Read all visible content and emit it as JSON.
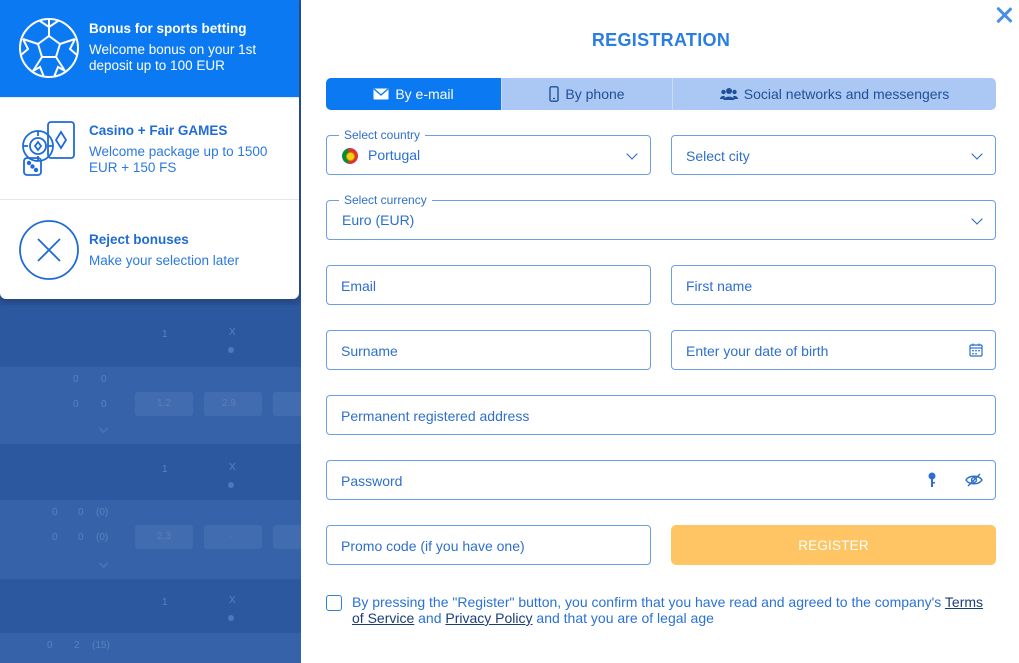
{
  "bonuses": {
    "items": [
      {
        "title": "Bonus for sports betting",
        "desc": "Welcome bonus on your 1st deposit up to 100 EUR",
        "icon": "soccer-ball-icon"
      },
      {
        "title": "Casino + Fair GAMES",
        "desc": "Welcome package up to 1500 EUR + 150 FS",
        "icon": "casino-chips-cards-icon"
      },
      {
        "title": "Reject bonuses",
        "desc": "Make your selection later",
        "icon": "reject-x-icon"
      }
    ]
  },
  "background": {
    "values": [
      "1",
      "X",
      "0",
      "0",
      "0",
      "0",
      "1.2",
      "2.9",
      "1",
      "X",
      "0",
      "0",
      "(0)",
      "0",
      "0",
      "(0)",
      "2.3",
      "-",
      "1",
      "X",
      "0",
      "2",
      "(15)"
    ]
  },
  "modal": {
    "title": "REGISTRATION",
    "tabs": [
      "By e-mail",
      "By phone",
      "Social networks and messengers"
    ],
    "country": {
      "label": "Select country",
      "value": "Portugal"
    },
    "city": {
      "placeholder": "Select city"
    },
    "currency": {
      "label": "Select currency",
      "value": "Euro (EUR)"
    },
    "email": {
      "placeholder": "Email"
    },
    "first_name": {
      "placeholder": "First name"
    },
    "surname": {
      "placeholder": "Surname"
    },
    "dob": {
      "placeholder": "Enter your date of birth"
    },
    "address": {
      "placeholder": "Permanent registered address"
    },
    "password": {
      "placeholder": "Password"
    },
    "promo": {
      "placeholder": "Promo code (if you have one)"
    },
    "register_label": "REGISTER",
    "terms": {
      "before": "By pressing the \"Register\" button, you confirm that you have read and agreed to the company's ",
      "terms_link": "Terms of Service",
      "and": " and ",
      "privacy_link": "Privacy Policy",
      "after": " and that you are of legal age"
    }
  },
  "colors": {
    "accent": "#0b79f1",
    "register": "#ffc564",
    "border": "#6a9fe3"
  }
}
